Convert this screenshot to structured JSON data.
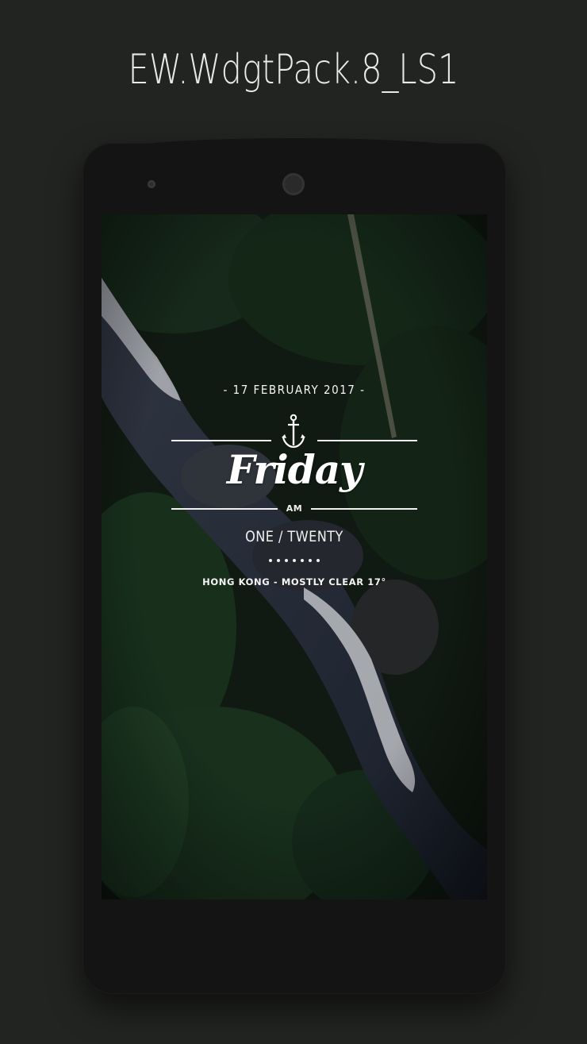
{
  "header": {
    "title": "EW.WdgtPack.8_LS1"
  },
  "widget": {
    "date": "- 17 FEBRUARY 2017 -",
    "day": "Friday",
    "ampm": "AM",
    "time": "ONE / TWENTY",
    "dot_count": 7,
    "weather": "HONG KONG - MOSTLY CLEAR 17°"
  },
  "icons": {
    "anchor": "anchor-icon"
  },
  "colors": {
    "page_background": "#222421",
    "phone_body": "#141414",
    "widget_text": "#ffffff"
  }
}
